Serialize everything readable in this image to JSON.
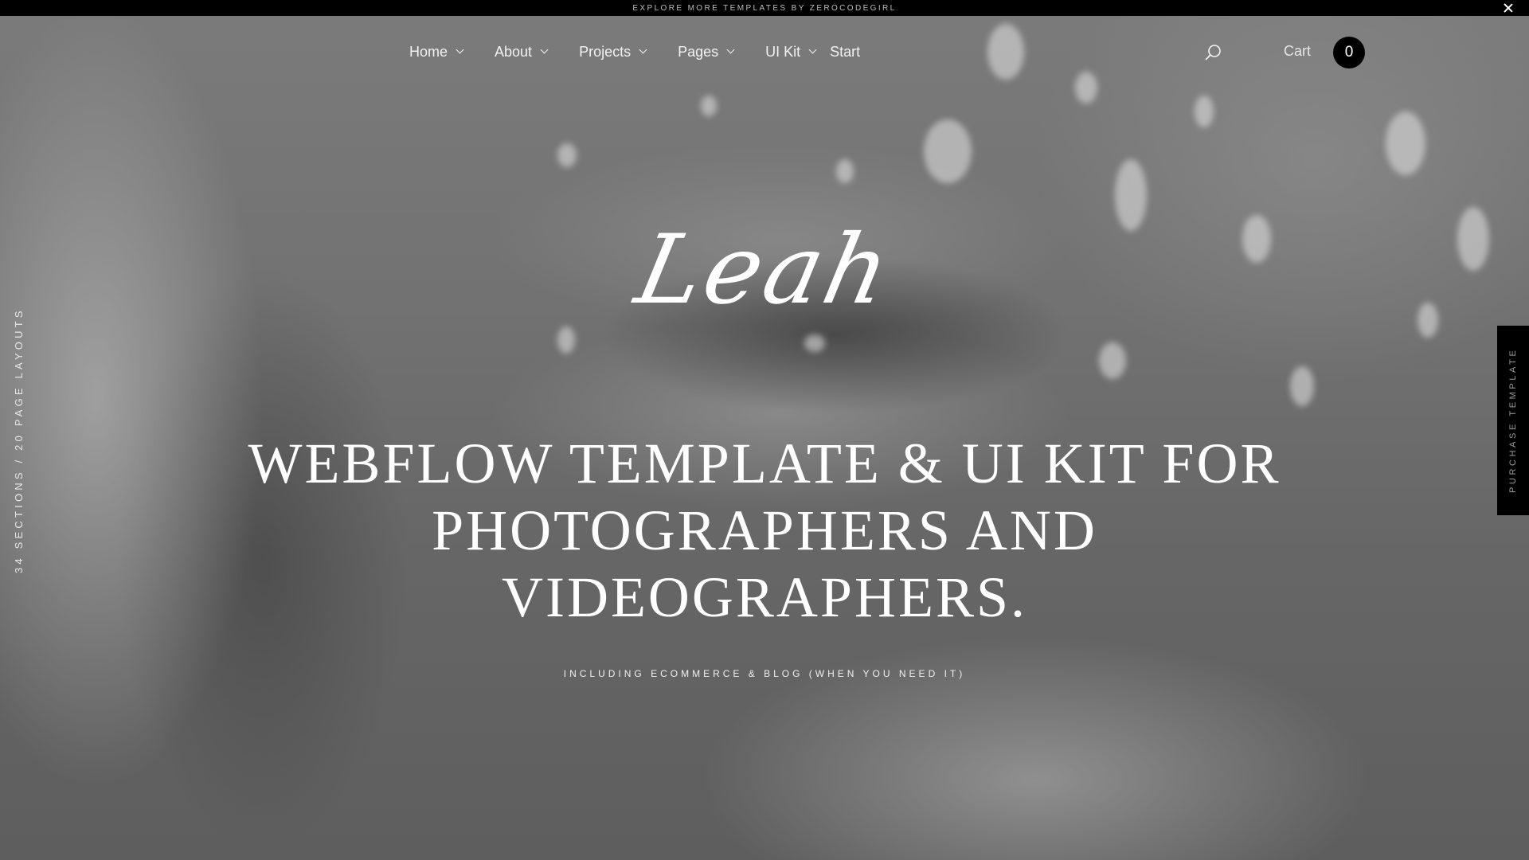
{
  "top_bar": {
    "text": "Explore more templates by Zerocodegirl"
  },
  "nav": {
    "items": [
      {
        "label": "Home"
      },
      {
        "label": "About"
      },
      {
        "label": "Projects"
      },
      {
        "label": "Pages"
      },
      {
        "label": "UI Kit"
      }
    ],
    "start_label": "Start",
    "search_icon": "search-icon",
    "cart_label": "Cart",
    "cart_count": "0"
  },
  "hero": {
    "logo": "Leah",
    "headline": "Webflow template & UI kit for photographers and videographers.",
    "subline": "Including ecommerce & blog (when you need it)"
  },
  "side": {
    "left_text": "34 Sections / 20 Page Layouts",
    "purchase_label": "Purchase Template"
  },
  "colors": {
    "top_bar_bg": "#000000",
    "cart_badge_bg": "#000000",
    "text": "#ffffff"
  }
}
